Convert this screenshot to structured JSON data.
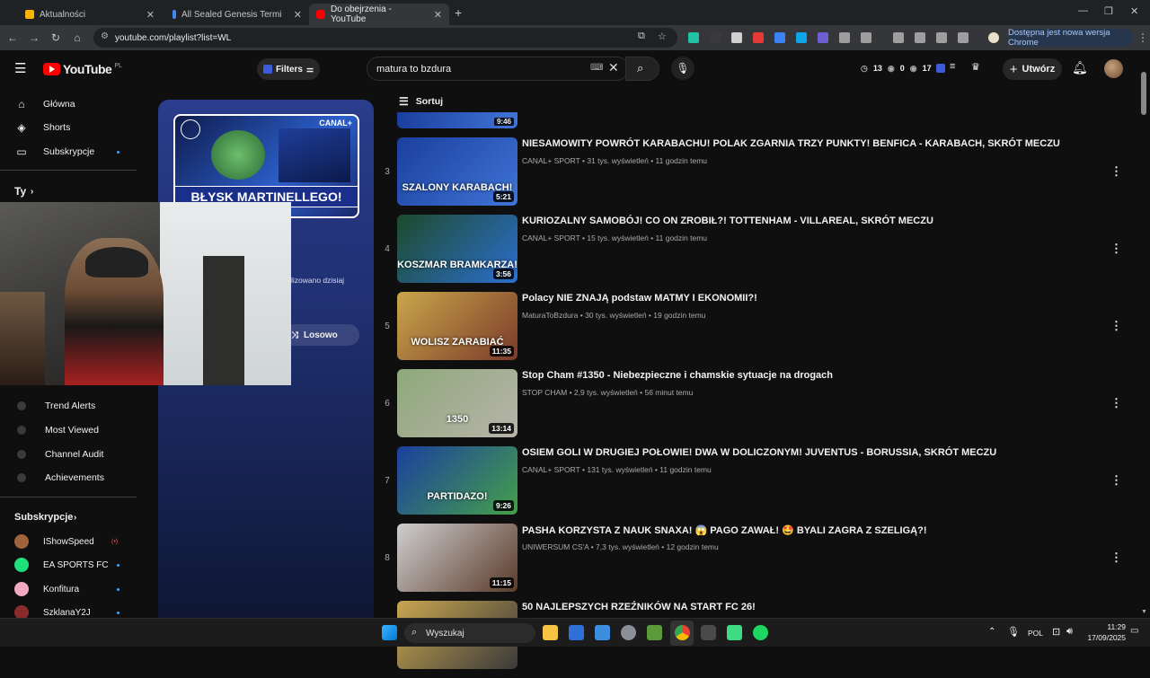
{
  "tabs": [
    {
      "title": "Aktualności",
      "color": "#f4b400"
    },
    {
      "title": "All Sealed Genesis Terminal Sk...",
      "color": "#4285f4"
    },
    {
      "title": "Do obejrzenia - YouTube",
      "color": "#ff0000"
    }
  ],
  "browser": {
    "url": "youtube.com/playlist?list=WL",
    "update_label": "Dostępna jest nowa wersja Chrome"
  },
  "yt": {
    "logo": "YouTube",
    "logo_region": "PL",
    "filters_label": "Filters",
    "search_value": "matura to bzdura",
    "stats": {
      "a": "13",
      "b": "0",
      "c": "17"
    },
    "create_label": "Utwórz"
  },
  "sidebar": {
    "top": [
      {
        "label": "Główna",
        "icon": "home-icon",
        "glyph": "⌂"
      },
      {
        "label": "Shorts",
        "icon": "shorts-icon",
        "glyph": "◈"
      },
      {
        "label": "Subskrypcje",
        "icon": "subscriptions-icon",
        "glyph": "▭"
      }
    ],
    "you_label": "Ty",
    "ext": [
      {
        "label": "Trend Alerts"
      },
      {
        "label": "Most Viewed"
      },
      {
        "label": "Channel Audit"
      },
      {
        "label": "Achievements"
      }
    ],
    "subs_label": "Subskrypcje",
    "subs": [
      {
        "label": "IShowSpeed",
        "color": "#a0633c",
        "live": "(•)"
      },
      {
        "label": "EA SPORTS FC",
        "color": "#1fe17b",
        "live": ""
      },
      {
        "label": "Konfitura",
        "color": "#f2a9c2",
        "live": ""
      },
      {
        "label": "SzklanaY2J",
        "color": "#8a2b2b",
        "live": ""
      }
    ]
  },
  "playlist": {
    "thumb_caption": "BŁYSK MARTINELLEGO!",
    "thumb_brand": "CANAL+",
    "updated": "lizowano dzisiaj",
    "shuffle": "Losowo"
  },
  "sort_label": "Sortuj",
  "prev_duration": "9:46",
  "videos": [
    {
      "index": "3",
      "title": "NIESAMOWITY POWRÓT KARABACHU! POLAK ZGARNIA TRZY PUNKTY! BENFICA - KARABACH, SKRÓT MECZU",
      "meta": "CANAL+ SPORT • 31 tys. wyświetleń • 11 godzin temu",
      "duration": "5:21",
      "caption": "SZALONY KARABACH!",
      "bg1": "#1b3f9e",
      "bg2": "#3f74d6"
    },
    {
      "index": "4",
      "title": "KURIOZALNY SAMOBÓJ! CO ON ZROBIŁ?! TOTTENHAM - VILLAREAL, SKRÓT MECZU",
      "meta": "CANAL+ SPORT • 15 tys. wyświetleń • 11 godzin temu",
      "duration": "3:56",
      "caption": "KOSZMAR BRAMKARZA!",
      "bg1": "#1d4a2a",
      "bg2": "#2c6fd0"
    },
    {
      "index": "5",
      "title": "Polacy NIE ZNAJĄ podstaw MATMY I EKONOMII?!",
      "meta": "MaturaToBzdura • 30 tys. wyświetleń • 19 godzin temu",
      "duration": "11:35",
      "caption": "WOLISZ ZARABIAĆ",
      "bg1": "#caa64a",
      "bg2": "#7a3a2a"
    },
    {
      "index": "6",
      "title": "Stop Cham #1350 - Niebezpieczne i chamskie sytuacje na drogach",
      "meta": "STOP CHAM • 2,9 tys. wyświetleń • 56 minut temu",
      "duration": "13:14",
      "caption": "1350",
      "bg1": "#8ea87a",
      "bg2": "#b7b4aa"
    },
    {
      "index": "7",
      "title": "OSIEM GOLI W DRUGIEJ POŁOWIE! DWA W DOLICZONYM! JUVENTUS - BORUSSIA, SKRÓT MECZU",
      "meta": "CANAL+ SPORT • 131 tys. wyświetleń • 11 godzin temu",
      "duration": "9:26",
      "caption": "PARTIDAZO!",
      "bg1": "#1b3f9e",
      "bg2": "#45a04a"
    },
    {
      "index": "8",
      "title": "PASHA KORZYSTA Z NAUK SNAXA! 😱 PAGO ZAWAŁ! 🤩 BYALI ZAGRA Z SZELIGĄ?!",
      "meta": "UNIWERSUM CS'A • 7,3 tys. wyświetleń • 12 godzin temu",
      "duration": "11:15",
      "caption": "",
      "bg1": "#cfcfcf",
      "bg2": "#5a3a2a"
    },
    {
      "index": "",
      "title": "50 NAJLEPSZYCH RZEŹNIKÓW NA START FC 26!",
      "meta": "",
      "duration": "",
      "caption": "",
      "bg1": "#c9a650",
      "bg2": "#3a3a3a"
    }
  ],
  "taskbar": {
    "search": "Wyszukaj",
    "lang": "POL",
    "time": "11:29",
    "date": "17/09/2025"
  }
}
